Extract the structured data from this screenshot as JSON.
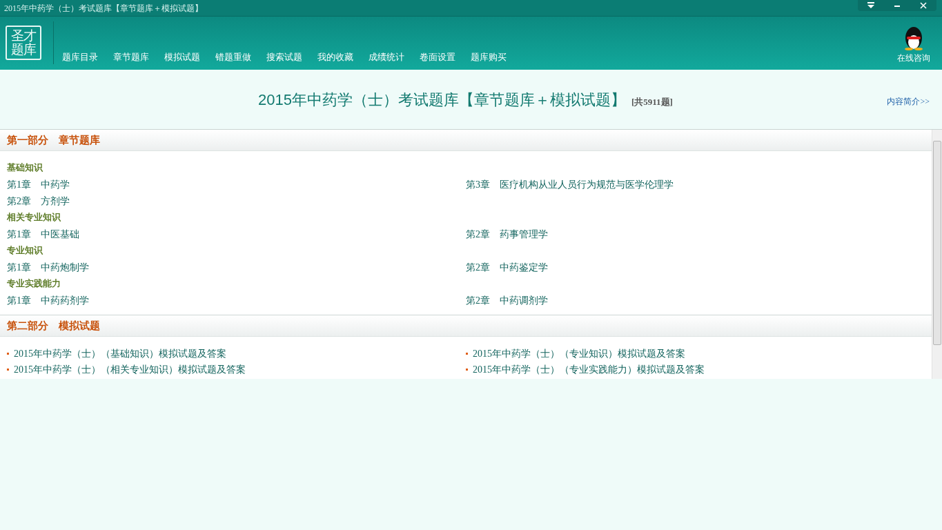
{
  "window": {
    "title": "2015年中药学（士）考试题库【章节题库＋模拟试题】",
    "controls": [
      {
        "kind": "dropdown"
      },
      {
        "kind": "minimize"
      },
      {
        "kind": "close"
      }
    ]
  },
  "logo": {
    "lines": [
      "圣才",
      "题库"
    ]
  },
  "nav": [
    "题库目录",
    "章节题库",
    "模拟试题",
    "错题重做",
    "搜索试题",
    "我的收藏",
    "成绩统计",
    "卷面设置",
    "题库购买"
  ],
  "consult": {
    "label": "在线咨询"
  },
  "heading": {
    "title": "2015年中药学（士）考试题库【章节题库＋模拟试题】",
    "count": "[共5911题]",
    "intro_link": "内容简介>>"
  },
  "sections": [
    {
      "kind": "chapters",
      "label": "第一部分　章节题库",
      "groups": [
        {
          "label": "基础知识",
          "items": [
            "第1章　中药学",
            "第3章　医疗机构从业人员行为规范与医学伦理学",
            "第2章　方剂学"
          ]
        },
        {
          "label": "相关专业知识",
          "items": [
            "第1章　中医基础",
            "第2章　药事管理学"
          ]
        },
        {
          "label": "专业知识",
          "items": [
            "第1章　中药炮制学",
            "第2章　中药鉴定学"
          ]
        },
        {
          "label": "专业实践能力",
          "items": [
            "第1章　中药药剂学",
            "第2章　中药调剂学"
          ]
        }
      ]
    },
    {
      "kind": "tests",
      "label": "第二部分　模拟试题",
      "items": [
        "2015年中药学（士）（基础知识）模拟试题及答案",
        "2015年中药学（士）（专业知识）模拟试题及答案",
        "2015年中药学（士）（相关专业知识）模拟试题及答案",
        "2015年中药学（士）（专业实践能力）模拟试题及答案"
      ]
    }
  ]
}
